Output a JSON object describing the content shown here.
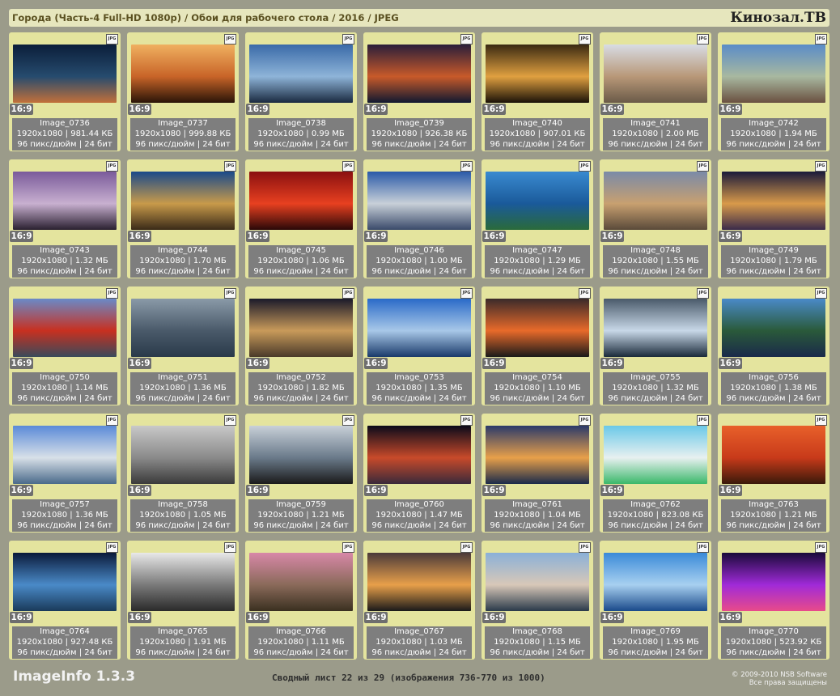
{
  "header": {
    "title": "Города (Часть-4 Full-HD 1080p) / Обои для рабочего стола / 2016 / JPEG",
    "brand": "Кинозал.ТВ"
  },
  "footer": {
    "app_name": "ImageInfo 1.3.3",
    "sheet_info": "Сводный лист 22 из 29 (изображения 736-770 из 1000)",
    "copyright_line1": "© 2009-2010 NSB Software",
    "copyright_line2": "Все права защищены"
  },
  "common": {
    "format_badge": "JPG",
    "aspect_ratio": "16:9",
    "resolution": "1920x1080",
    "dpi_line": "96 пикс/дюйм | 24 бит"
  },
  "images": [
    {
      "name": "Image_0736",
      "size": "981.44 КБ",
      "colors": [
        "#0b1e3a",
        "#264b6e",
        "#c2703a"
      ]
    },
    {
      "name": "Image_0737",
      "size": "999.88 КБ",
      "colors": [
        "#f0b060",
        "#c86428",
        "#2a1408"
      ]
    },
    {
      "name": "Image_0738",
      "size": "0.99 МБ",
      "colors": [
        "#3a6aa8",
        "#8eb4d8",
        "#1a2a40"
      ]
    },
    {
      "name": "Image_0739",
      "size": "926.38 КБ",
      "colors": [
        "#2a1e3a",
        "#c85a2a",
        "#101830"
      ]
    },
    {
      "name": "Image_0740",
      "size": "907.01 КБ",
      "colors": [
        "#3a2a12",
        "#e0a040",
        "#1a1208"
      ]
    },
    {
      "name": "Image_0741",
      "size": "2.00 МБ",
      "colors": [
        "#d8dce4",
        "#b89878",
        "#6a5a48"
      ]
    },
    {
      "name": "Image_0742",
      "size": "1.94 МБ",
      "colors": [
        "#5a8cc8",
        "#a8b8a0",
        "#6a5040"
      ]
    },
    {
      "name": "Image_0743",
      "size": "1.32 МБ",
      "colors": [
        "#7a5a9a",
        "#c8b0d0",
        "#2a2030"
      ]
    },
    {
      "name": "Image_0744",
      "size": "1.70 МБ",
      "colors": [
        "#1a4a8a",
        "#c89a4a",
        "#3a2a18"
      ]
    },
    {
      "name": "Image_0745",
      "size": "1.06 МБ",
      "colors": [
        "#8a1010",
        "#e84020",
        "#2a0808"
      ]
    },
    {
      "name": "Image_0746",
      "size": "1.00 МБ",
      "colors": [
        "#2a5aa8",
        "#c8d0d8",
        "#3a4a6a"
      ]
    },
    {
      "name": "Image_0747",
      "size": "1.29 МБ",
      "colors": [
        "#3a8ad0",
        "#1a5a9a",
        "#2a6a3a"
      ]
    },
    {
      "name": "Image_0748",
      "size": "1.55 МБ",
      "colors": [
        "#7a8aa8",
        "#c8a070",
        "#5a4a3a"
      ]
    },
    {
      "name": "Image_0749",
      "size": "1.79 МБ",
      "colors": [
        "#1a1a3a",
        "#d89a4a",
        "#3a2a4a"
      ]
    },
    {
      "name": "Image_0750",
      "size": "1.14 МБ",
      "colors": [
        "#6a8ac8",
        "#c83020",
        "#3a4a5a"
      ]
    },
    {
      "name": "Image_0751",
      "size": "1.36 МБ",
      "colors": [
        "#8a9aa8",
        "#4a5a6a",
        "#2a3a4a"
      ]
    },
    {
      "name": "Image_0752",
      "size": "1.82 МБ",
      "colors": [
        "#1a1a2a",
        "#c89a5a",
        "#4a3a2a"
      ]
    },
    {
      "name": "Image_0753",
      "size": "1.35 МБ",
      "colors": [
        "#2a6ac8",
        "#a8c8e8",
        "#1a3a6a"
      ]
    },
    {
      "name": "Image_0754",
      "size": "1.10 МБ",
      "colors": [
        "#3a2a2a",
        "#e86a2a",
        "#1a1a1a"
      ]
    },
    {
      "name": "Image_0755",
      "size": "1.32 МБ",
      "colors": [
        "#4a5a6a",
        "#c8d8e8",
        "#1a2a3a"
      ]
    },
    {
      "name": "Image_0756",
      "size": "1.38 МБ",
      "colors": [
        "#4a8ac8",
        "#2a5a3a",
        "#1a2a4a"
      ]
    },
    {
      "name": "Image_0757",
      "size": "1.36 МБ",
      "colors": [
        "#5a8ad8",
        "#d8e0e8",
        "#4a6a8a"
      ]
    },
    {
      "name": "Image_0758",
      "size": "1.05 МБ",
      "colors": [
        "#c8c8c8",
        "#8a8a8a",
        "#3a3a3a"
      ]
    },
    {
      "name": "Image_0759",
      "size": "1.21 МБ",
      "colors": [
        "#c8d0d8",
        "#6a7a8a",
        "#1a1a1a"
      ]
    },
    {
      "name": "Image_0760",
      "size": "1.47 МБ",
      "colors": [
        "#0a0a1a",
        "#c84a2a",
        "#3a2a3a"
      ]
    },
    {
      "name": "Image_0761",
      "size": "1.04 МБ",
      "colors": [
        "#2a3a6a",
        "#e8a04a",
        "#1a2a4a"
      ]
    },
    {
      "name": "Image_0762",
      "size": "823.08 КБ",
      "colors": [
        "#6ac8e8",
        "#e8f0f0",
        "#3ab86a"
      ]
    },
    {
      "name": "Image_0763",
      "size": "1.21 МБ",
      "colors": [
        "#e8602a",
        "#c83a1a",
        "#3a1a0a"
      ]
    },
    {
      "name": "Image_0764",
      "size": "927.48 КБ",
      "colors": [
        "#0a1a3a",
        "#4a8ac8",
        "#1a3a5a"
      ]
    },
    {
      "name": "Image_0765",
      "size": "1.91 МБ",
      "colors": [
        "#e8e8e8",
        "#7a7a7a",
        "#2a2a2a"
      ]
    },
    {
      "name": "Image_0766",
      "size": "1.11 МБ",
      "colors": [
        "#d888a8",
        "#8a6a5a",
        "#3a3020"
      ]
    },
    {
      "name": "Image_0767",
      "size": "1.03 МБ",
      "colors": [
        "#4a3a3a",
        "#e8a04a",
        "#1a1a1a"
      ]
    },
    {
      "name": "Image_0768",
      "size": "1.15 МБ",
      "colors": [
        "#8ab0d8",
        "#d8c8b8",
        "#2a3a4a"
      ]
    },
    {
      "name": "Image_0769",
      "size": "1.95 МБ",
      "colors": [
        "#3a8ad8",
        "#a8d0f0",
        "#1a4a8a"
      ]
    },
    {
      "name": "Image_0770",
      "size": "523.92 КБ",
      "colors": [
        "#1a0a3a",
        "#a02ad8",
        "#e84a8a"
      ]
    }
  ]
}
